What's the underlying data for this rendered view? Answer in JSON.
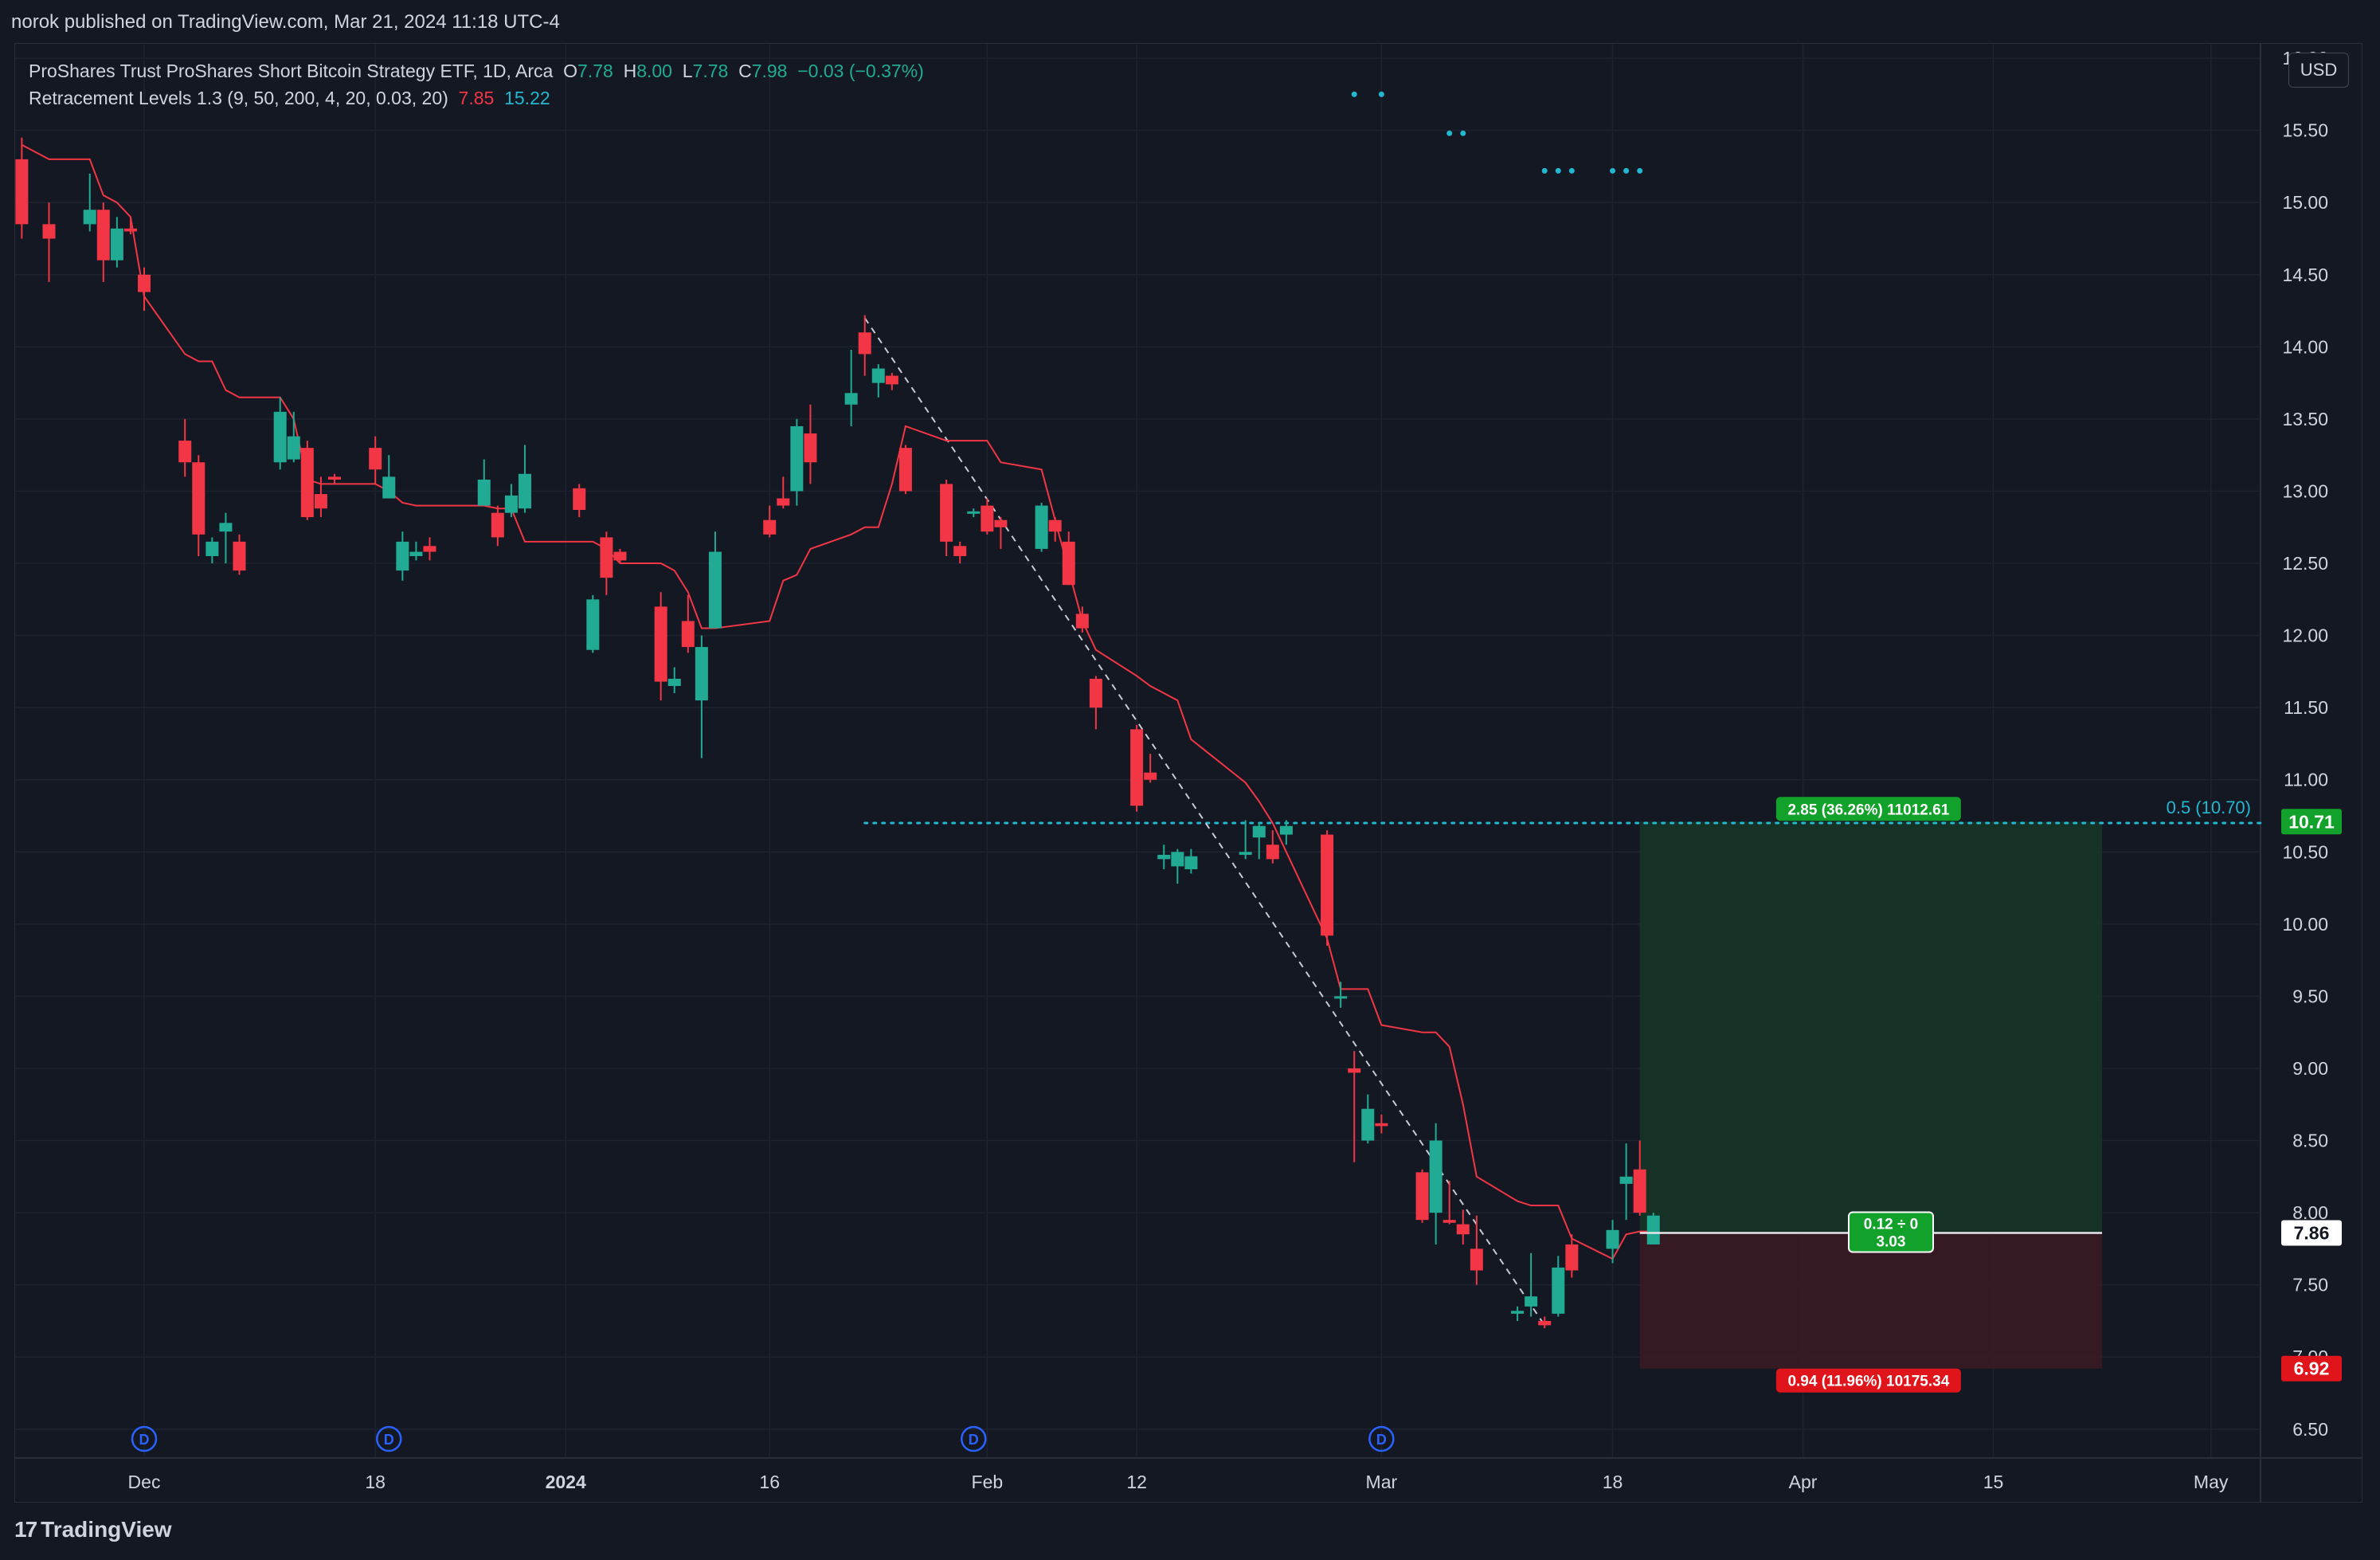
{
  "header": {
    "published": "norok published on TradingView.com, Mar 21, 2024 11:18 UTC-4"
  },
  "legend": {
    "symbol": "ProShares Trust ProShares Short Bitcoin Strategy ETF, 1D, Arca",
    "o_label": "O",
    "o_value": "7.78",
    "h_label": "H",
    "h_value": "8.00",
    "l_label": "L",
    "l_value": "7.78",
    "c_label": "C",
    "c_value": "7.98",
    "change": "−0.03 (−0.37%)",
    "indicator": "Retracement Levels 1.3 (9, 50, 200, 4, 20, 0.03, 20)",
    "ind_value1": "7.85",
    "ind_value2": "15.22"
  },
  "toolbar": {
    "currency": "USD"
  },
  "footer": {
    "brand": "TradingView",
    "brand_mark": "17"
  },
  "colors": {
    "background": "#141823",
    "grid": "#1f2330",
    "up": "#22ab94",
    "down": "#f23645",
    "trail_line": "#f23645",
    "fib": "#22b8cf",
    "dividend": "#2962ff",
    "profit_zone": "#163527",
    "loss_zone": "#3a1b24",
    "profit_label": "#12a12a",
    "loss_label": "#e0141b"
  },
  "chart_data": {
    "type": "candlestick",
    "y_axis": {
      "min": 6.3,
      "max": 16.1,
      "position": "right",
      "ticks": [
        "6.50",
        "7.00",
        "7.50",
        "8.00",
        "8.50",
        "9.00",
        "9.50",
        "10.00",
        "10.50",
        "11.00",
        "11.50",
        "12.00",
        "12.50",
        "13.00",
        "13.50",
        "14.00",
        "14.50",
        "15.00",
        "15.50",
        "16.00"
      ]
    },
    "x_axis": {
      "labels": [
        {
          "text": "Dec",
          "date": "2023-12-01",
          "bold": false
        },
        {
          "text": "18",
          "date": "2023-12-18",
          "bold": false
        },
        {
          "text": "2024",
          "date": "2024-01-01",
          "bold": true
        },
        {
          "text": "16",
          "date": "2024-01-16",
          "bold": false
        },
        {
          "text": "Feb",
          "date": "2024-02-01",
          "bold": false
        },
        {
          "text": "12",
          "date": "2024-02-12",
          "bold": false
        },
        {
          "text": "Mar",
          "date": "2024-03-01",
          "bold": false
        },
        {
          "text": "18",
          "date": "2024-03-18",
          "bold": false
        },
        {
          "text": "Apr",
          "date": "2024-04-01",
          "bold": false
        },
        {
          "text": "15",
          "date": "2024-04-15",
          "bold": false
        },
        {
          "text": "May",
          "date": "2024-05-01",
          "bold": false
        }
      ]
    },
    "grid": true,
    "candles": [
      {
        "d": "2023-11-22",
        "o": 15.3,
        "h": 15.45,
        "l": 14.75,
        "c": 14.85
      },
      {
        "d": "2023-11-24",
        "o": 14.85,
        "h": 15.0,
        "l": 14.45,
        "c": 14.75
      },
      {
        "d": "2023-11-27",
        "o": 14.85,
        "h": 15.2,
        "l": 14.8,
        "c": 14.95
      },
      {
        "d": "2023-11-28",
        "o": 14.95,
        "h": 15.0,
        "l": 14.45,
        "c": 14.6
      },
      {
        "d": "2023-11-29",
        "o": 14.6,
        "h": 14.9,
        "l": 14.55,
        "c": 14.82
      },
      {
        "d": "2023-11-30",
        "o": 14.82,
        "h": 14.9,
        "l": 14.78,
        "c": 14.8
      },
      {
        "d": "2023-12-01",
        "o": 14.5,
        "h": 14.55,
        "l": 14.25,
        "c": 14.38
      },
      {
        "d": "2023-12-04",
        "o": 13.35,
        "h": 13.5,
        "l": 13.1,
        "c": 13.2
      },
      {
        "d": "2023-12-05",
        "o": 13.2,
        "h": 13.25,
        "l": 12.55,
        "c": 12.7
      },
      {
        "d": "2023-12-06",
        "o": 12.55,
        "h": 12.68,
        "l": 12.5,
        "c": 12.65
      },
      {
        "d": "2023-12-07",
        "o": 12.72,
        "h": 12.85,
        "l": 12.5,
        "c": 12.78
      },
      {
        "d": "2023-12-08",
        "o": 12.65,
        "h": 12.7,
        "l": 12.42,
        "c": 12.45
      },
      {
        "d": "2023-12-11",
        "o": 13.2,
        "h": 13.65,
        "l": 13.15,
        "c": 13.55
      },
      {
        "d": "2023-12-12",
        "o": 13.22,
        "h": 13.55,
        "l": 13.2,
        "c": 13.38
      },
      {
        "d": "2023-12-13",
        "o": 13.3,
        "h": 13.35,
        "l": 12.8,
        "c": 12.82
      },
      {
        "d": "2023-12-14",
        "o": 12.98,
        "h": 13.1,
        "l": 12.82,
        "c": 12.88
      },
      {
        "d": "2023-12-15",
        "o": 13.1,
        "h": 13.12,
        "l": 13.05,
        "c": 13.08
      },
      {
        "d": "2023-12-18",
        "o": 13.3,
        "h": 13.38,
        "l": 13.05,
        "c": 13.15
      },
      {
        "d": "2023-12-19",
        "o": 12.95,
        "h": 13.25,
        "l": 12.95,
        "c": 13.1
      },
      {
        "d": "2023-12-20",
        "o": 12.45,
        "h": 12.72,
        "l": 12.38,
        "c": 12.65
      },
      {
        "d": "2023-12-21",
        "o": 12.55,
        "h": 12.65,
        "l": 12.52,
        "c": 12.58
      },
      {
        "d": "2023-12-22",
        "o": 12.62,
        "h": 12.68,
        "l": 12.52,
        "c": 12.58
      },
      {
        "d": "2023-12-26",
        "o": 12.9,
        "h": 13.22,
        "l": 12.9,
        "c": 13.08
      },
      {
        "d": "2023-12-27",
        "o": 12.85,
        "h": 12.9,
        "l": 12.62,
        "c": 12.68
      },
      {
        "d": "2023-12-28",
        "o": 12.85,
        "h": 13.05,
        "l": 12.82,
        "c": 12.97
      },
      {
        "d": "2023-12-29",
        "o": 12.88,
        "h": 13.32,
        "l": 12.85,
        "c": 13.12
      },
      {
        "d": "2024-01-02",
        "o": 13.02,
        "h": 13.05,
        "l": 12.82,
        "c": 12.87
      },
      {
        "d": "2024-01-03",
        "o": 11.9,
        "h": 12.28,
        "l": 11.88,
        "c": 12.25
      },
      {
        "d": "2024-01-04",
        "o": 12.68,
        "h": 12.72,
        "l": 12.28,
        "c": 12.4
      },
      {
        "d": "2024-01-05",
        "o": 12.58,
        "h": 12.6,
        "l": 12.5,
        "c": 12.52
      },
      {
        "d": "2024-01-08",
        "o": 12.2,
        "h": 12.3,
        "l": 11.55,
        "c": 11.68
      },
      {
        "d": "2024-01-09",
        "o": 11.65,
        "h": 11.78,
        "l": 11.6,
        "c": 11.7
      },
      {
        "d": "2024-01-10",
        "o": 12.1,
        "h": 12.28,
        "l": 11.88,
        "c": 11.92
      },
      {
        "d": "2024-01-11",
        "o": 11.55,
        "h": 12.0,
        "l": 11.15,
        "c": 11.92
      },
      {
        "d": "2024-01-12",
        "o": 12.05,
        "h": 12.72,
        "l": 12.05,
        "c": 12.58
      },
      {
        "d": "2024-01-16",
        "o": 12.8,
        "h": 12.9,
        "l": 12.68,
        "c": 12.7
      },
      {
        "d": "2024-01-17",
        "o": 12.95,
        "h": 13.1,
        "l": 12.88,
        "c": 12.9
      },
      {
        "d": "2024-01-18",
        "o": 13.0,
        "h": 13.5,
        "l": 12.9,
        "c": 13.45
      },
      {
        "d": "2024-01-19",
        "o": 13.4,
        "h": 13.6,
        "l": 13.05,
        "c": 13.2
      },
      {
        "d": "2024-01-22",
        "o": 13.6,
        "h": 13.98,
        "l": 13.45,
        "c": 13.68
      },
      {
        "d": "2024-01-23",
        "o": 14.1,
        "h": 14.22,
        "l": 13.8,
        "c": 13.95
      },
      {
        "d": "2024-01-24",
        "o": 13.75,
        "h": 13.88,
        "l": 13.65,
        "c": 13.85
      },
      {
        "d": "2024-01-25",
        "o": 13.8,
        "h": 13.82,
        "l": 13.7,
        "c": 13.74
      },
      {
        "d": "2024-01-26",
        "o": 13.3,
        "h": 13.32,
        "l": 12.98,
        "c": 13.0
      },
      {
        "d": "2024-01-29",
        "o": 13.05,
        "h": 13.08,
        "l": 12.55,
        "c": 12.65
      },
      {
        "d": "2024-01-30",
        "o": 12.62,
        "h": 12.65,
        "l": 12.5,
        "c": 12.55
      },
      {
        "d": "2024-01-31",
        "o": 12.85,
        "h": 12.88,
        "l": 12.82,
        "c": 12.86
      },
      {
        "d": "2024-02-01",
        "o": 12.9,
        "h": 12.95,
        "l": 12.7,
        "c": 12.72
      },
      {
        "d": "2024-02-02",
        "o": 12.8,
        "h": 12.82,
        "l": 12.6,
        "c": 12.75
      },
      {
        "d": "2024-02-05",
        "o": 12.6,
        "h": 12.92,
        "l": 12.58,
        "c": 12.9
      },
      {
        "d": "2024-02-06",
        "o": 12.8,
        "h": 12.82,
        "l": 12.65,
        "c": 12.72
      },
      {
        "d": "2024-02-07",
        "o": 12.65,
        "h": 12.72,
        "l": 12.35,
        "c": 12.35
      },
      {
        "d": "2024-02-08",
        "o": 12.15,
        "h": 12.2,
        "l": 12.02,
        "c": 12.05
      },
      {
        "d": "2024-02-09",
        "o": 11.7,
        "h": 11.72,
        "l": 11.35,
        "c": 11.5
      },
      {
        "d": "2024-02-12",
        "o": 11.35,
        "h": 11.38,
        "l": 10.78,
        "c": 10.82
      },
      {
        "d": "2024-02-13",
        "o": 11.05,
        "h": 11.18,
        "l": 10.98,
        "c": 11.0
      },
      {
        "d": "2024-02-14",
        "o": 10.45,
        "h": 10.55,
        "l": 10.38,
        "c": 10.48
      },
      {
        "d": "2024-02-15",
        "o": 10.4,
        "h": 10.52,
        "l": 10.28,
        "c": 10.5
      },
      {
        "d": "2024-02-16",
        "o": 10.38,
        "h": 10.52,
        "l": 10.35,
        "c": 10.47
      },
      {
        "d": "2024-02-20",
        "o": 10.48,
        "h": 10.72,
        "l": 10.45,
        "c": 10.5
      },
      {
        "d": "2024-02-21",
        "o": 10.6,
        "h": 10.7,
        "l": 10.45,
        "c": 10.68
      },
      {
        "d": "2024-02-22",
        "o": 10.55,
        "h": 10.65,
        "l": 10.42,
        "c": 10.45
      },
      {
        "d": "2024-02-23",
        "o": 10.62,
        "h": 10.72,
        "l": 10.55,
        "c": 10.68
      },
      {
        "d": "2024-02-26",
        "o": 10.62,
        "h": 10.65,
        "l": 9.85,
        "c": 9.92
      },
      {
        "d": "2024-02-27",
        "o": 9.5,
        "h": 9.6,
        "l": 9.42,
        "c": 9.5
      },
      {
        "d": "2024-02-28",
        "o": 9.0,
        "h": 9.12,
        "l": 8.35,
        "c": 8.97
      },
      {
        "d": "2024-02-29",
        "o": 8.5,
        "h": 8.82,
        "l": 8.48,
        "c": 8.72
      },
      {
        "d": "2024-03-01",
        "o": 8.62,
        "h": 8.68,
        "l": 8.55,
        "c": 8.6
      },
      {
        "d": "2024-03-04",
        "o": 8.28,
        "h": 8.3,
        "l": 7.93,
        "c": 7.95
      },
      {
        "d": "2024-03-05",
        "o": 8.0,
        "h": 8.62,
        "l": 7.78,
        "c": 8.5
      },
      {
        "d": "2024-03-06",
        "o": 7.95,
        "h": 8.22,
        "l": 7.92,
        "c": 7.93
      },
      {
        "d": "2024-03-07",
        "o": 7.92,
        "h": 8.02,
        "l": 7.78,
        "c": 7.85
      },
      {
        "d": "2024-03-08",
        "o": 7.75,
        "h": 7.98,
        "l": 7.5,
        "c": 7.6
      },
      {
        "d": "2024-03-11",
        "o": 7.3,
        "h": 7.35,
        "l": 7.25,
        "c": 7.32
      },
      {
        "d": "2024-03-12",
        "o": 7.35,
        "h": 7.72,
        "l": 7.28,
        "c": 7.42
      },
      {
        "d": "2024-03-13",
        "o": 7.25,
        "h": 7.28,
        "l": 7.2,
        "c": 7.22
      },
      {
        "d": "2024-03-14",
        "o": 7.3,
        "h": 7.7,
        "l": 7.28,
        "c": 7.62
      },
      {
        "d": "2024-03-15",
        "o": 7.78,
        "h": 7.85,
        "l": 7.55,
        "c": 7.6
      },
      {
        "d": "2024-03-18",
        "o": 7.75,
        "h": 7.95,
        "l": 7.65,
        "c": 7.88
      },
      {
        "d": "2024-03-19",
        "o": 8.2,
        "h": 8.48,
        "l": 7.95,
        "c": 8.25
      },
      {
        "d": "2024-03-20",
        "o": 8.3,
        "h": 8.5,
        "l": 7.98,
        "c": 8.0
      },
      {
        "d": "2024-03-21",
        "o": 7.78,
        "h": 8.0,
        "l": 7.78,
        "c": 7.98
      }
    ],
    "trailing_line": [
      {
        "d": "2023-11-22",
        "v": 15.4
      },
      {
        "d": "2023-11-24",
        "v": 15.3
      },
      {
        "d": "2023-11-27",
        "v": 15.3
      },
      {
        "d": "2023-11-28",
        "v": 15.05
      },
      {
        "d": "2023-11-29",
        "v": 15.0
      },
      {
        "d": "2023-11-30",
        "v": 14.9
      },
      {
        "d": "2023-12-01",
        "v": 14.35
      },
      {
        "d": "2023-12-04",
        "v": 13.95
      },
      {
        "d": "2023-12-05",
        "v": 13.9
      },
      {
        "d": "2023-12-06",
        "v": 13.9
      },
      {
        "d": "2023-12-07",
        "v": 13.7
      },
      {
        "d": "2023-12-08",
        "v": 13.65
      },
      {
        "d": "2023-12-11",
        "v": 13.65
      },
      {
        "d": "2023-12-12",
        "v": 13.5
      },
      {
        "d": "2023-12-13",
        "v": 13.08
      },
      {
        "d": "2023-12-14",
        "v": 13.05
      },
      {
        "d": "2023-12-15",
        "v": 13.05
      },
      {
        "d": "2023-12-18",
        "v": 13.05
      },
      {
        "d": "2023-12-19",
        "v": 13.0
      },
      {
        "d": "2023-12-20",
        "v": 12.92
      },
      {
        "d": "2023-12-21",
        "v": 12.9
      },
      {
        "d": "2023-12-22",
        "v": 12.9
      },
      {
        "d": "2023-12-26",
        "v": 12.9
      },
      {
        "d": "2023-12-27",
        "v": 12.88
      },
      {
        "d": "2023-12-28",
        "v": 12.88
      },
      {
        "d": "2023-12-29",
        "v": 12.65
      },
      {
        "d": "2024-01-02",
        "v": 12.65
      },
      {
        "d": "2024-01-03",
        "v": 12.65
      },
      {
        "d": "2024-01-04",
        "v": 12.6
      },
      {
        "d": "2024-01-05",
        "v": 12.5
      },
      {
        "d": "2024-01-08",
        "v": 12.5
      },
      {
        "d": "2024-01-09",
        "v": 12.45
      },
      {
        "d": "2024-01-10",
        "v": 12.3
      },
      {
        "d": "2024-01-11",
        "v": 12.05
      },
      {
        "d": "2024-01-12",
        "v": 12.05
      },
      {
        "d": "2024-01-16",
        "v": 12.1
      },
      {
        "d": "2024-01-17",
        "v": 12.38
      },
      {
        "d": "2024-01-18",
        "v": 12.42
      },
      {
        "d": "2024-01-19",
        "v": 12.6
      },
      {
        "d": "2024-01-22",
        "v": 12.7
      },
      {
        "d": "2024-01-23",
        "v": 12.75
      },
      {
        "d": "2024-01-24",
        "v": 12.75
      },
      {
        "d": "2024-01-25",
        "v": 13.05
      },
      {
        "d": "2024-01-26",
        "v": 13.45
      },
      {
        "d": "2024-01-29",
        "v": 13.35
      },
      {
        "d": "2024-01-30",
        "v": 13.35
      },
      {
        "d": "2024-01-31",
        "v": 13.35
      },
      {
        "d": "2024-02-01",
        "v": 13.35
      },
      {
        "d": "2024-02-02",
        "v": 13.2
      },
      {
        "d": "2024-02-05",
        "v": 13.15
      },
      {
        "d": "2024-02-06",
        "v": 12.8
      },
      {
        "d": "2024-02-07",
        "v": 12.45
      },
      {
        "d": "2024-02-08",
        "v": 12.1
      },
      {
        "d": "2024-02-09",
        "v": 11.9
      },
      {
        "d": "2024-02-12",
        "v": 11.72
      },
      {
        "d": "2024-02-13",
        "v": 11.65
      },
      {
        "d": "2024-02-14",
        "v": 11.6
      },
      {
        "d": "2024-02-15",
        "v": 11.55
      },
      {
        "d": "2024-02-16",
        "v": 11.28
      },
      {
        "d": "2024-02-20",
        "v": 10.98
      },
      {
        "d": "2024-02-21",
        "v": 10.85
      },
      {
        "d": "2024-02-22",
        "v": 10.7
      },
      {
        "d": "2024-02-23",
        "v": 10.5
      },
      {
        "d": "2024-02-26",
        "v": 9.9
      },
      {
        "d": "2024-02-27",
        "v": 9.55
      },
      {
        "d": "2024-02-28",
        "v": 9.55
      },
      {
        "d": "2024-02-29",
        "v": 9.55
      },
      {
        "d": "2024-03-01",
        "v": 9.3
      },
      {
        "d": "2024-03-04",
        "v": 9.25
      },
      {
        "d": "2024-03-05",
        "v": 9.25
      },
      {
        "d": "2024-03-06",
        "v": 9.15
      },
      {
        "d": "2024-03-07",
        "v": 8.75
      },
      {
        "d": "2024-03-08",
        "v": 8.25
      },
      {
        "d": "2024-03-11",
        "v": 8.08
      },
      {
        "d": "2024-03-12",
        "v": 8.05
      },
      {
        "d": "2024-03-13",
        "v": 8.05
      },
      {
        "d": "2024-03-14",
        "v": 8.05
      },
      {
        "d": "2024-03-15",
        "v": 7.82
      },
      {
        "d": "2024-03-18",
        "v": 7.68
      },
      {
        "d": "2024-03-19",
        "v": 7.85
      },
      {
        "d": "2024-03-20",
        "v": 7.87
      },
      {
        "d": "2024-03-21",
        "v": 7.87
      }
    ],
    "fib_dots": [
      {
        "d": "2024-02-28",
        "v": 15.75
      },
      {
        "d": "2024-03-01",
        "v": 15.75
      },
      {
        "d": "2024-03-06",
        "v": 15.48
      },
      {
        "d": "2024-03-07",
        "v": 15.48
      },
      {
        "d": "2024-03-13",
        "v": 15.22
      },
      {
        "d": "2024-03-14",
        "v": 15.22
      },
      {
        "d": "2024-03-15",
        "v": 15.22
      },
      {
        "d": "2024-03-18",
        "v": 15.22
      },
      {
        "d": "2024-03-19",
        "v": 15.22
      },
      {
        "d": "2024-03-20",
        "v": 15.22
      }
    ],
    "trend_line": {
      "from": {
        "d": "2024-01-23",
        "v": 14.2
      },
      "to": {
        "d": "2024-03-13",
        "v": 7.22
      }
    },
    "fib_level": {
      "value": 10.7,
      "from": "2024-01-23",
      "label": "0.5 (10.70)"
    },
    "position": {
      "entry": 7.86,
      "target": 10.71,
      "stop": 6.92,
      "from": "2024-03-20",
      "to": "2024-04-23",
      "target_label": "2.85 (36.26%) 11012.61",
      "stop_label": "0.94 (11.96%) 10175.34",
      "center_label_1": "0.12 ÷ 0",
      "center_label_2": "3.03"
    },
    "price_tags": [
      {
        "value": 10.71,
        "text": "10.71",
        "bg": "#12a12a",
        "color": "#ffffff"
      },
      {
        "value": 7.86,
        "text": "7.86",
        "bg": "#ffffff",
        "color": "#131722"
      },
      {
        "value": 6.92,
        "text": "6.92",
        "bg": "#e0141b",
        "color": "#ffffff"
      }
    ],
    "dividends": [
      "2023-12-01",
      "2023-12-19",
      "2024-01-31",
      "2024-03-01"
    ],
    "dividend_marker": "D"
  }
}
